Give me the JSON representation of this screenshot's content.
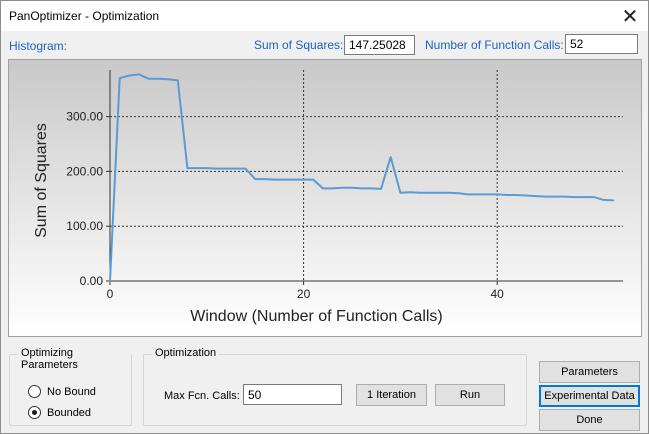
{
  "window": {
    "title": "PanOptimizer - Optimization",
    "close_glyph": "✕"
  },
  "header": {
    "histogram_label": "Histogram:",
    "sum_of_squares_label": "Sum of Squares:",
    "sum_of_squares_value": "147.25028",
    "function_calls_label": "Number of Function Calls:",
    "function_calls_value": "52"
  },
  "chart_data": {
    "type": "line",
    "xlabel": "Window (Number of Function Calls)",
    "ylabel": "Sum of Squares",
    "xlim": [
      0,
      53
    ],
    "ylim": [
      0,
      385
    ],
    "xticks": [
      0,
      20,
      40
    ],
    "xtick_labels": [
      "0",
      "20",
      "40"
    ],
    "yticks": [
      0,
      100,
      200,
      300
    ],
    "ytick_labels": [
      "0.00",
      "100.00",
      "200.00",
      "300.00"
    ],
    "grid": "dotted at x=20,40 and y=100,200,300",
    "line_color": "#5b9bd5",
    "x": [
      0,
      1,
      2,
      3,
      4,
      5,
      6,
      7,
      8,
      9,
      10,
      11,
      12,
      13,
      14,
      15,
      16,
      17,
      18,
      19,
      20,
      21,
      22,
      23,
      24,
      25,
      26,
      27,
      28,
      29,
      30,
      31,
      32,
      33,
      34,
      35,
      36,
      37,
      38,
      39,
      40,
      41,
      42,
      43,
      44,
      45,
      46,
      47,
      48,
      49,
      50,
      51,
      52
    ],
    "y": [
      0,
      370,
      375,
      377,
      369,
      369,
      368,
      366,
      206,
      206,
      206,
      205,
      205,
      205,
      205,
      186,
      186,
      185,
      185,
      185,
      185,
      185,
      169,
      169,
      170,
      170,
      169,
      169,
      168,
      226,
      161,
      162,
      161,
      161,
      161,
      161,
      160,
      158,
      158,
      158,
      158,
      157,
      157,
      156,
      155,
      154,
      154,
      154,
      153,
      153,
      153,
      148,
      147
    ]
  },
  "optimizing_parameters": {
    "title": "Optimizing Parameters",
    "options": [
      {
        "label": "No Bound",
        "checked": false
      },
      {
        "label": "Bounded",
        "checked": true
      }
    ]
  },
  "optimization": {
    "title": "Optimization",
    "max_calls_label": "Max Fcn. Calls:",
    "max_calls_value": "50",
    "iteration_button": "1 Iteration",
    "run_button": "Run"
  },
  "side_buttons": {
    "parameters": "Parameters",
    "experimental_data": "Experimental Data",
    "done": "Done"
  }
}
